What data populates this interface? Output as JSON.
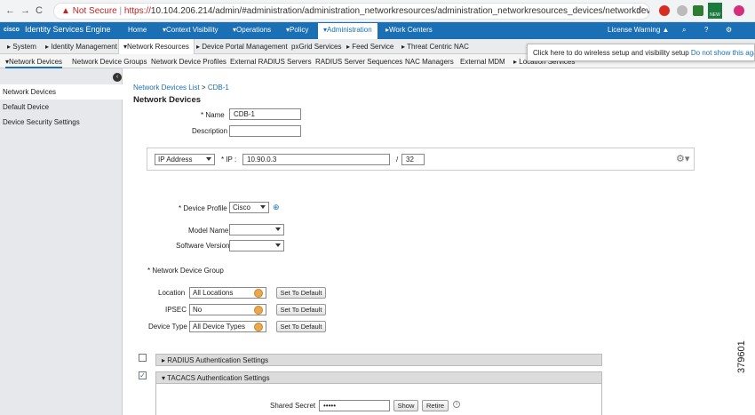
{
  "browser": {
    "back": "←",
    "forward": "→",
    "reload": "C",
    "security_label": "Not Secure",
    "url_https": "https://",
    "url_rest": "10.104.206.214/admin/#administration/administration_networkresources/administration_networkresources_devices/networkdevices",
    "ext_badge": "NEW"
  },
  "app": {
    "logo": "cisco",
    "title": "Identity Services Engine",
    "menu": [
      "Home",
      "▾Context Visibility",
      "▾Operations",
      "▾Policy",
      "▾Administration",
      "▸Work Centers"
    ],
    "license_warning": "License Warning ▲"
  },
  "subnav": [
    "▸ System",
    "▸ Identity Management",
    "▾Network Resources",
    "▸ Device Portal Management",
    "pxGrid Services",
    "▸ Feed Service",
    "▸ Threat Centric NAC"
  ],
  "tabs": [
    "▾Network Devices",
    "Network Device Groups",
    "Network Device Profiles",
    "External RADIUS Servers",
    "RADIUS Server Sequences",
    "NAC Managers",
    "External MDM",
    "▸ Location Services"
  ],
  "tooltip": {
    "text": "Click here to do wireless setup and visibility setup",
    "link": "Do not show this again."
  },
  "sidebar": {
    "items": [
      "Network Devices",
      "Default Device",
      "Device Security Settings"
    ]
  },
  "breadcrumb": {
    "link": "Network Devices List",
    "sep": ">",
    "current": "CDB-1"
  },
  "heading": "Network Devices",
  "form": {
    "name_label": "* Name",
    "name_value": "CDB-1",
    "description_label": "Description",
    "description_value": "",
    "ip_type": "IP Address",
    "ip_label": "* IP :",
    "ip_value": "10.90.0.3",
    "mask_sep": "/",
    "mask_value": "32",
    "device_profile_label": "* Device Profile",
    "device_profile_value": "Cisco",
    "model_name_label": "Model Name",
    "software_version_label": "Software Version",
    "ndg_label": "* Network Device Group",
    "location_label": "Location",
    "location_value": "All Locations",
    "ipsec_label": "IPSEC",
    "ipsec_value": "No",
    "device_type_label": "Device Type",
    "device_type_value": "All Device Types",
    "set_default": "Set To Default",
    "radius_label": "RADIUS Authentication Settings",
    "tacacs_label": "TACACS Authentication Settings",
    "shared_secret_label": "Shared Secret",
    "shared_secret_value": "•••••",
    "show_btn": "Show",
    "retire_btn": "Retire"
  },
  "watermark": "379601"
}
